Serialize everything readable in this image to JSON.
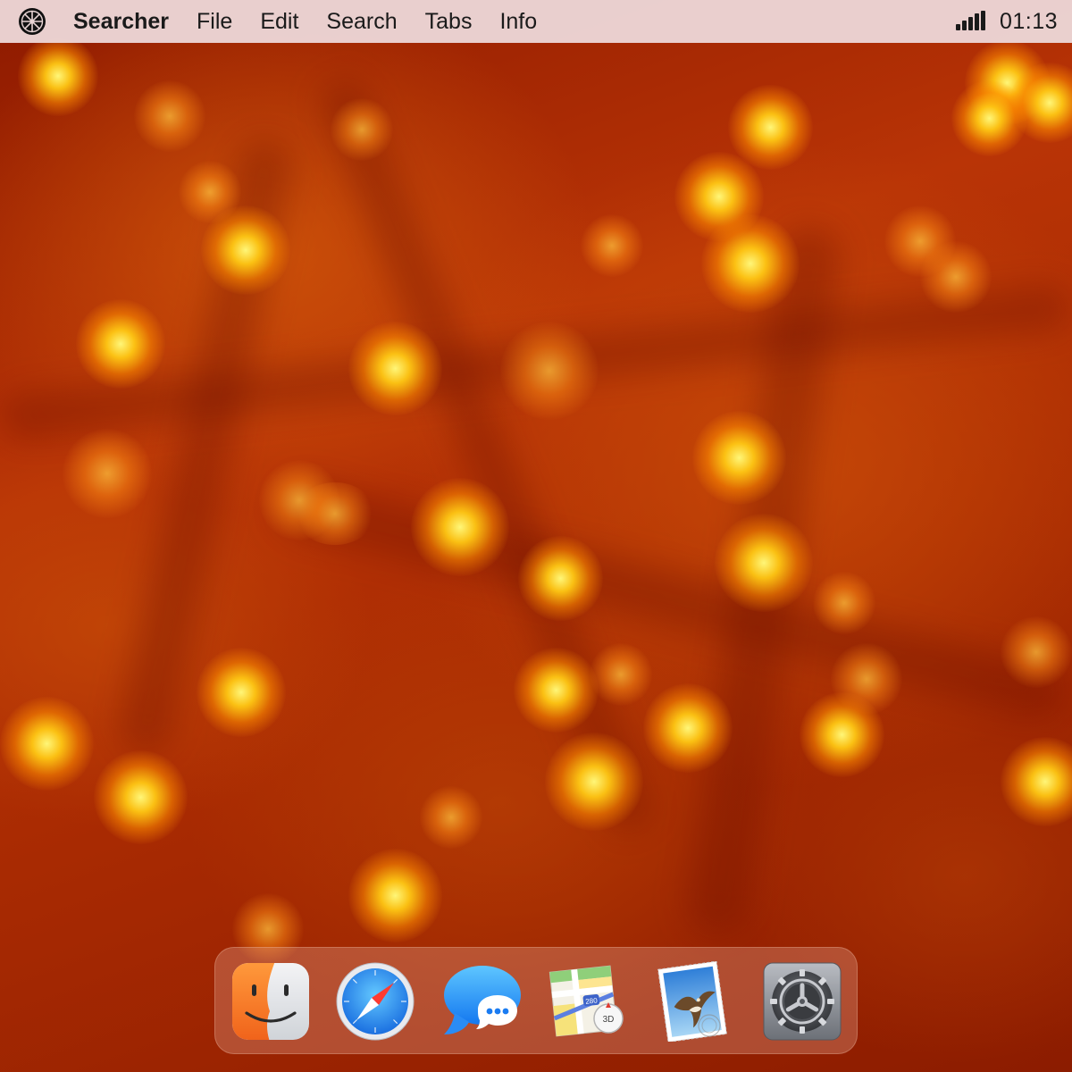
{
  "menubar": {
    "app_name": "Searcher",
    "menus": [
      {
        "label": "File"
      },
      {
        "label": "Edit"
      },
      {
        "label": "Search"
      },
      {
        "label": "Tabs"
      },
      {
        "label": "Info"
      }
    ],
    "clock": "01:13",
    "logo_icon": "wheel-logo-icon",
    "status_icon": "cellular-signal-icon"
  },
  "dock": {
    "apps": [
      {
        "name": "finder-icon"
      },
      {
        "name": "safari-icon"
      },
      {
        "name": "messages-icon"
      },
      {
        "name": "maps-icon",
        "badge": "280",
        "view": "3D"
      },
      {
        "name": "mail-icon"
      },
      {
        "name": "system-preferences-icon"
      }
    ]
  },
  "colors": {
    "menubar_bg": "#ecd6d6",
    "wallpaper_base": "#a82800",
    "bokeh": "#ffc814"
  }
}
